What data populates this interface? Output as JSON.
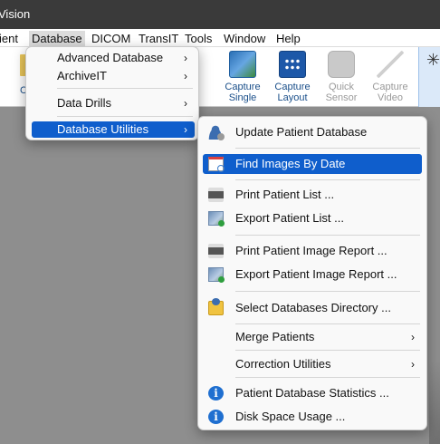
{
  "window": {
    "title": "Vision"
  },
  "menubar": [
    "ient",
    "Database",
    "DICOM",
    "TransIT",
    "Tools",
    "Window",
    "Help"
  ],
  "toolbar": {
    "left_label": "C",
    "buttons": [
      {
        "line1": "Capture",
        "line2": "Single",
        "icon": "capture-single-icon",
        "enabled": true
      },
      {
        "line1": "Capture",
        "line2": "Layout",
        "icon": "capture-layout-icon",
        "enabled": true
      },
      {
        "line1": "Quick",
        "line2": "Sensor",
        "icon": "quick-sensor-icon",
        "enabled": false
      },
      {
        "line1": "Capture",
        "line2": "Video",
        "icon": "capture-video-icon",
        "enabled": false
      }
    ]
  },
  "database_menu": {
    "items": [
      {
        "label": "Advanced Database",
        "submenu": true
      },
      {
        "label": "ArchiveIT",
        "submenu": true
      },
      {
        "label": "Data Drills",
        "submenu": true
      },
      {
        "label": "Database Utilities",
        "submenu": true,
        "highlighted": true
      }
    ],
    "arrow": "›"
  },
  "utilities_menu": {
    "items": [
      {
        "label": "Update Patient Database",
        "icon": "user-sync-icon"
      },
      {
        "label": "Find Images By Date",
        "icon": "find-images-icon",
        "highlighted": true
      },
      {
        "label": "Print Patient List ...",
        "icon": "printer-icon"
      },
      {
        "label": "Export Patient List ...",
        "icon": "export-icon"
      },
      {
        "label": "Print Patient Image Report ...",
        "icon": "printer-icon"
      },
      {
        "label": "Export Patient Image Report ...",
        "icon": "export-icon"
      },
      {
        "label": "Select Databases Directory ...",
        "icon": "folder-user-icon"
      },
      {
        "label": "Merge Patients",
        "submenu": true
      },
      {
        "label": "Correction Utilities",
        "submenu": true
      },
      {
        "label": "Patient Database Statistics ...",
        "icon": "info-icon"
      },
      {
        "label": "Disk Space Usage ...",
        "icon": "info-icon"
      }
    ],
    "arrow": "›",
    "info_glyph": "i"
  },
  "colors": {
    "highlight": "#0f5ecc",
    "titlebar": "#3a3a3a",
    "workspace": "#8e8e8e"
  }
}
